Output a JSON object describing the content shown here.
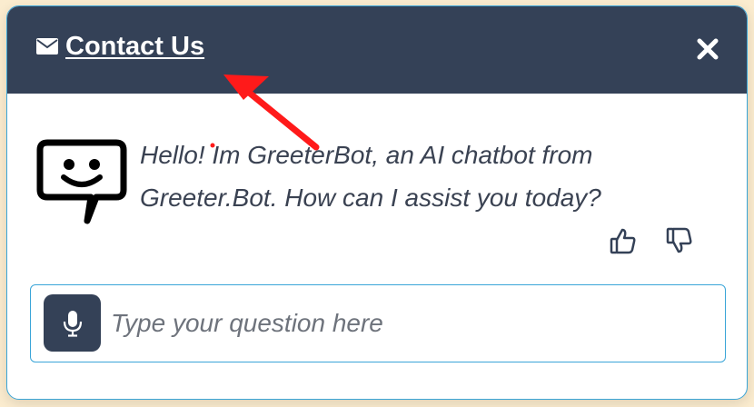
{
  "header": {
    "icon": "envelope-icon",
    "title": "Contact Us",
    "close_icon": "close-icon"
  },
  "bot": {
    "avatar_icon": "chat-smiley-icon",
    "message": "Hello! Im GreeterBot, an AI chatbot from Greeter.Bot. How can I assist you today?",
    "feedback": {
      "like_icon": "thumbs-up-icon",
      "dislike_icon": "thumbs-down-icon"
    }
  },
  "input": {
    "mic_icon": "microphone-icon",
    "value": "",
    "placeholder": "Type your question here"
  },
  "colors": {
    "header_bg": "#344157",
    "accent_border": "#3aa5d8",
    "page_bg": "#fbeccf",
    "annotation_arrow": "#ff1a1a"
  }
}
